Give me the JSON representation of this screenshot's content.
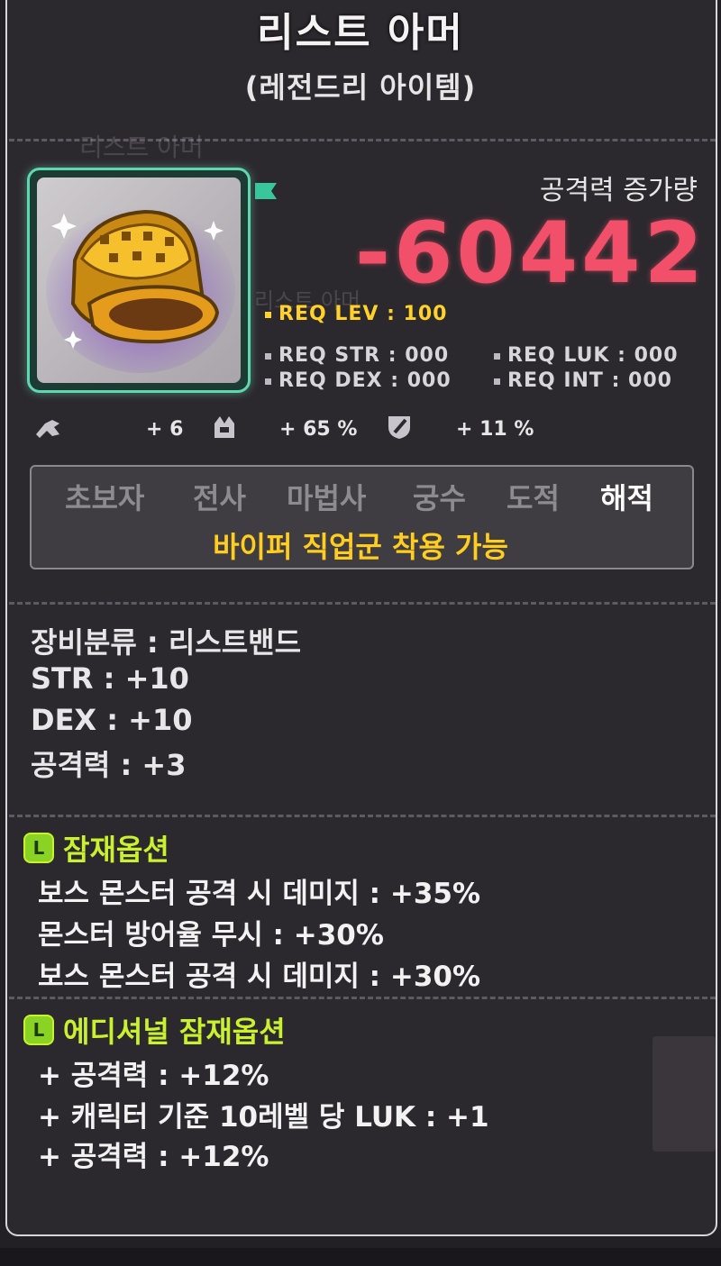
{
  "item": {
    "name": "리스트 아머",
    "grade": "(레전드리 아이템)",
    "ghost_name": "리스트 아머",
    "ghost_name_2": "리스트 아머"
  },
  "attack_change": {
    "label": "공격력 증가량",
    "value": "-60442"
  },
  "requirements": {
    "lev": "REQ LEV : 100",
    "str": "REQ STR : 000",
    "luk": "REQ LUK : 000",
    "dex": "REQ DEX : 000",
    "int": "REQ INT : 000"
  },
  "enhance": {
    "upgrade": "+ 6",
    "boss": "+ 65 %",
    "defense": "+ 11 %"
  },
  "jobs": {
    "list": [
      "초보자",
      "전사",
      "마법사",
      "궁수",
      "도적",
      "해적"
    ],
    "active": "해적",
    "note": "바이퍼 직업군 착용 가능"
  },
  "stats": {
    "category": "장비분류 : 리스트밴드",
    "str": "STR : +10",
    "dex": "DEX : +10",
    "atk": "공격력 : +3"
  },
  "potential": {
    "title": "잠재옵션",
    "lines": [
      "보스 몬스터 공격 시 데미지 : +35%",
      "몬스터 방어율 무시 : +30%",
      "보스 몬스터 공격 시 데미지 : +30%"
    ]
  },
  "additional_potential": {
    "title": "에디셔널 잠재옵션",
    "lines": [
      "+ 공격력 : +12%",
      "+ 캐릭터 기준 10레벨 당 LUK : +1",
      "+ 공격력 : +12%"
    ]
  },
  "colors": {
    "legendary": "#8ad223",
    "attack_change": "#f2506a",
    "req_level": "#ffd12a",
    "job_note": "#ffcd1f"
  }
}
